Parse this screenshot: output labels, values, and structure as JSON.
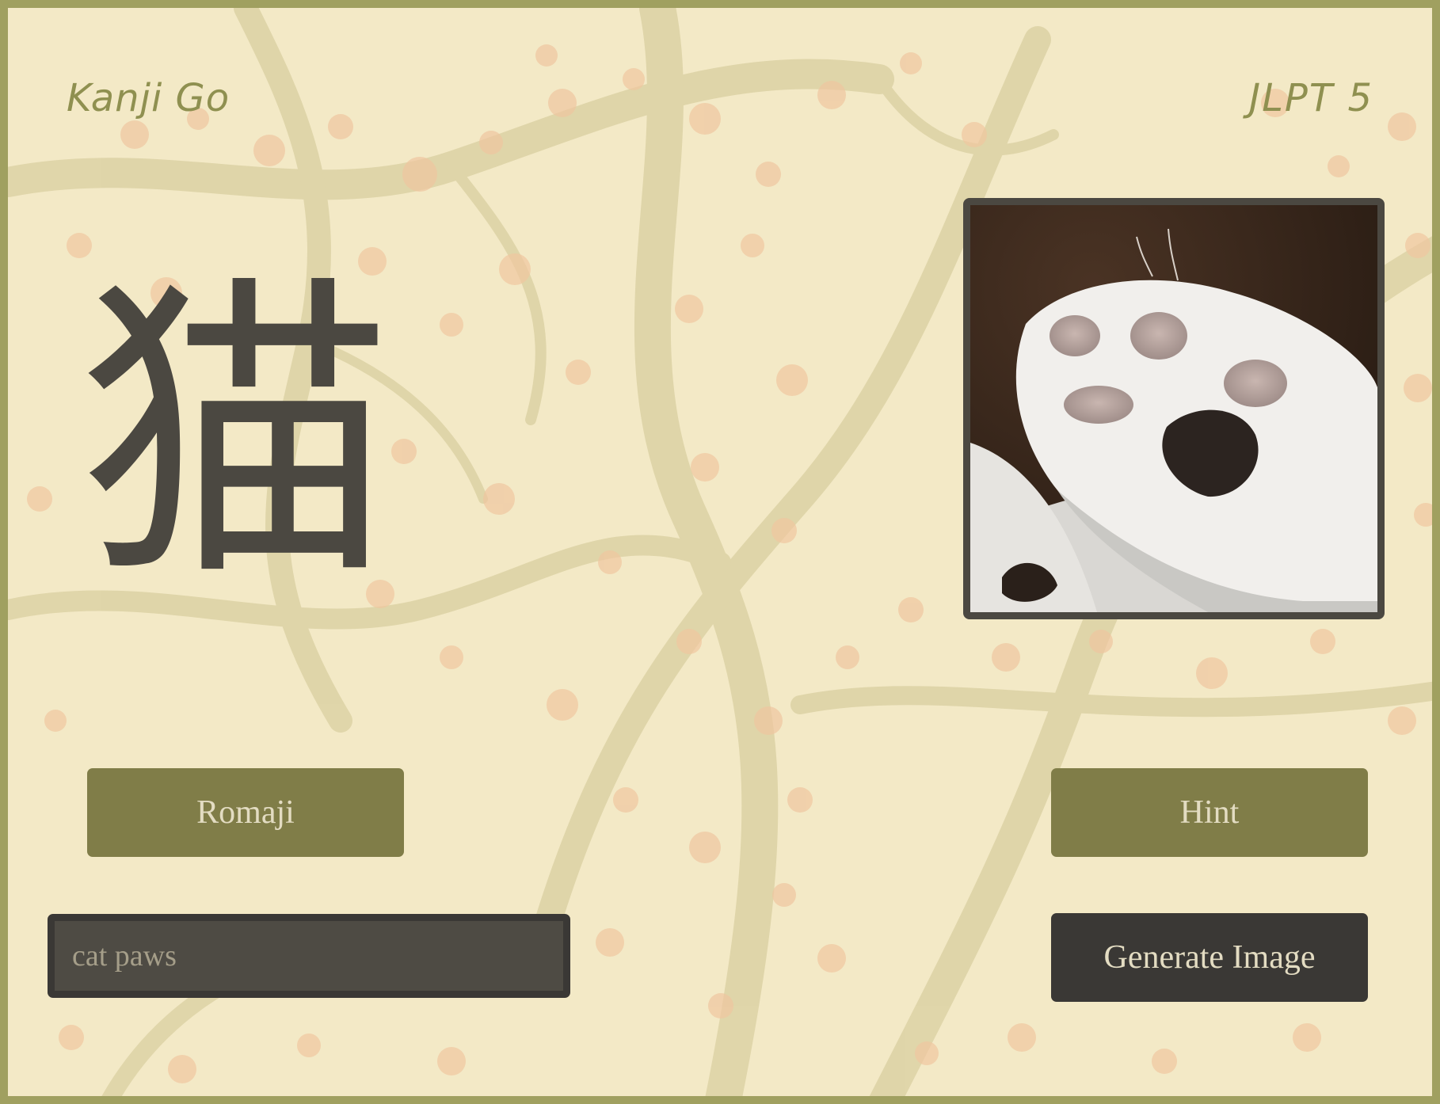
{
  "header": {
    "app_title": "Kanji Go",
    "level": "JLPT 5"
  },
  "card": {
    "kanji": "猫",
    "image_icon": "cat-paw-photo"
  },
  "buttons": {
    "romaji_label": "Romaji",
    "hint_label": "Hint",
    "generate_label": "Generate Image"
  },
  "prompt": {
    "value": "cat paws",
    "placeholder": ""
  },
  "colors": {
    "frame": "#a0a060",
    "accent_olive": "#807d48",
    "dark": "#3a3835",
    "kanji_ink": "#4b4841",
    "background": "#f3e9c6"
  }
}
